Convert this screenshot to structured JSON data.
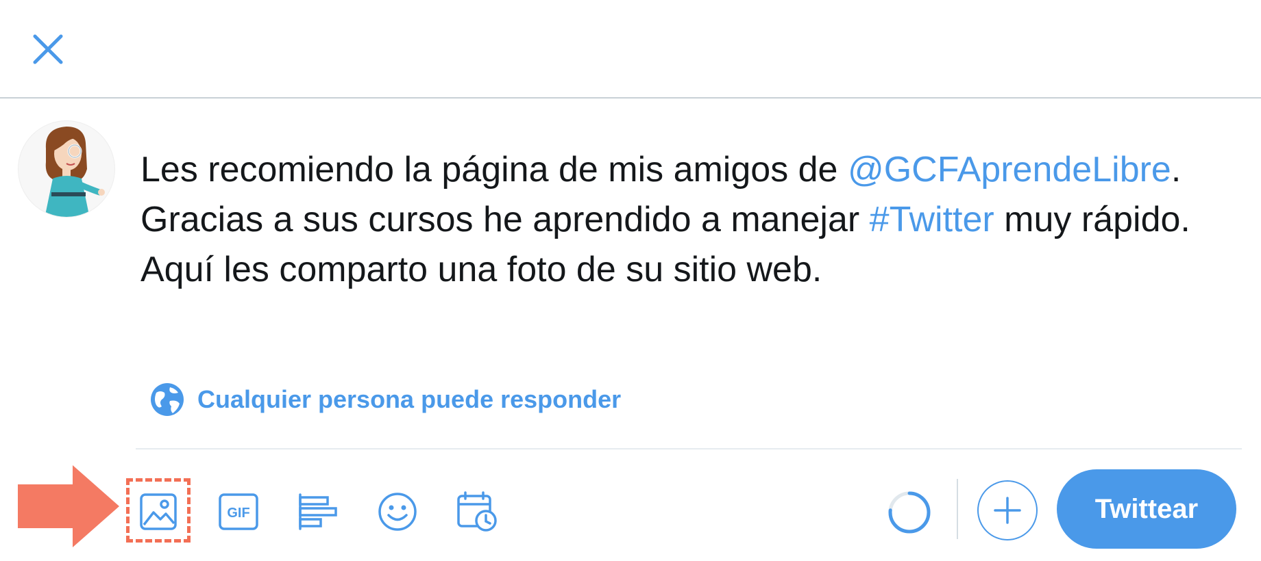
{
  "tweet": {
    "line1_pre": "Les recomiendo la página de mis amigos de ",
    "mention": "@GCFAprendeLibre",
    "line1_post": ".",
    "line2_pre": "Gracias a sus cursos he aprendido a manejar ",
    "hashtag": "#Twitter",
    "line2_post": " muy rápido.",
    "line3": "Aquí les comparto una foto de su sitio web."
  },
  "reply_setting": {
    "label": "Cualquier persona puede responder",
    "icon": "globe-icon"
  },
  "toolbar": {
    "icons": [
      "image-icon",
      "gif-icon",
      "poll-icon",
      "emoji-icon",
      "schedule-icon"
    ],
    "gif_label": "GIF",
    "tweet_button_label": "Twittear"
  },
  "colors": {
    "accent": "#4a99e9",
    "highlight": "#f36f55",
    "text": "#14171a",
    "divider": "#e6ecf0"
  }
}
